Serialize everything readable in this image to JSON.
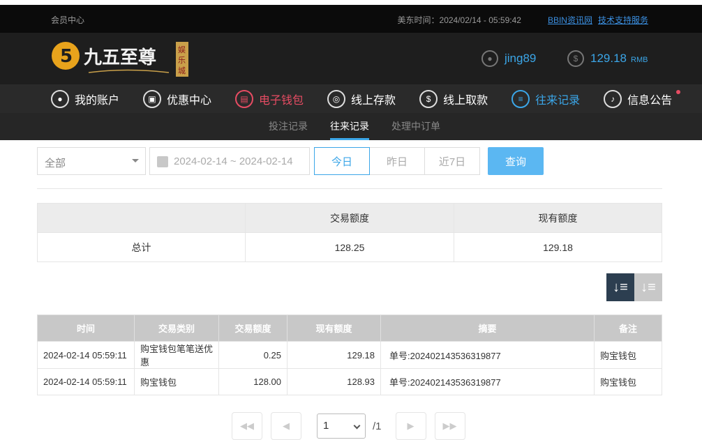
{
  "topbar": {
    "member_center": "会员中心",
    "time": "美东时间：2024/02/14 - 05:59:42",
    "link1": "BBIN资讯网",
    "link2": "技术支持服务"
  },
  "header": {
    "logo_text": "九五至尊",
    "logo_side": "娱乐城",
    "username": "jing89",
    "balance": "129.18",
    "balance_unit": "RMB"
  },
  "nav": {
    "items": [
      {
        "label": "我的账户",
        "icon": "user-icon"
      },
      {
        "label": "优惠中心",
        "icon": "gift-icon"
      },
      {
        "label": "电子钱包",
        "icon": "wallet-icon"
      },
      {
        "label": "线上存款",
        "icon": "deposit-icon"
      },
      {
        "label": "线上取款",
        "icon": "withdraw-icon"
      },
      {
        "label": "往来记录",
        "icon": "record-icon"
      },
      {
        "label": "信息公告",
        "icon": "bell-icon"
      }
    ]
  },
  "subnav": {
    "items": [
      "投注记录",
      "往来记录",
      "处理中订单"
    ],
    "active": "往来记录"
  },
  "filters": {
    "type_selected": "全部",
    "date_range": "2024-02-14 ~ 2024-02-14",
    "today": "今日",
    "yesterday": "昨日",
    "last7": "近7日",
    "query": "查询"
  },
  "summary": {
    "h1": "交易额度",
    "h2": "现有额度",
    "label": "总计",
    "trade": "128.25",
    "current": "129.18"
  },
  "table": {
    "headers": [
      "时间",
      "交易类别",
      "交易额度",
      "现有额度",
      "摘要",
      "备注"
    ],
    "rows": [
      [
        "2024-02-14 05:59:11",
        "购宝钱包笔笔送优惠",
        "0.25",
        "129.18",
        "单号:20240214353631987​7",
        "购宝钱包"
      ],
      [
        "2024-02-14 05:59:11",
        "购宝钱包",
        "128.00",
        "128.93",
        "单号:20240214353631987​7",
        "购宝钱包"
      ]
    ]
  },
  "pager": {
    "page": "1",
    "total": "/1"
  },
  "colors": {
    "accent": "#3ba6e8",
    "red": "#e74c63"
  }
}
